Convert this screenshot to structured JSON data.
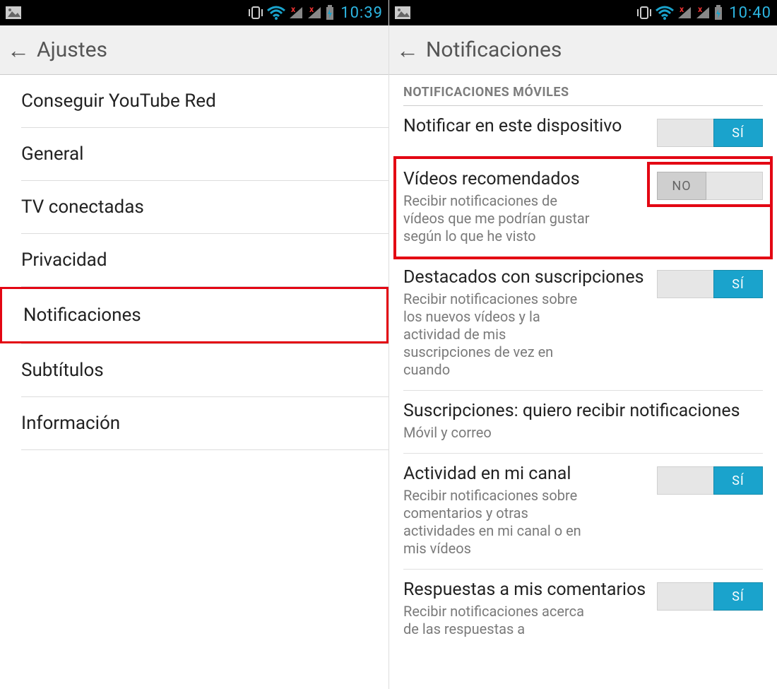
{
  "left": {
    "status_time": "10:39",
    "header_title": "Ajustes",
    "items": [
      "Conseguir YouTube Red",
      "General",
      "TV conectadas",
      "Privacidad",
      "Notificaciones",
      "Subtítulos",
      "Información"
    ],
    "highlight_index": 4
  },
  "right": {
    "status_time": "10:40",
    "header_title": "Notificaciones",
    "section_title": "NOTIFICACIONES MÓVILES",
    "items": [
      {
        "title": "Notificar en este dispositivo",
        "desc": "",
        "toggle": "SÍ",
        "on": true
      },
      {
        "title": "Vídeos recomendados",
        "desc": "Recibir notificaciones de vídeos que me podrían gustar según lo que he visto",
        "toggle": "NO",
        "on": false,
        "highlight": true
      },
      {
        "title": "Destacados con suscripciones",
        "desc": "Recibir notificaciones sobre los nuevos vídeos y la actividad de mis suscripciones de vez en cuando",
        "toggle": "SÍ",
        "on": true
      },
      {
        "title": "Suscripciones: quiero recibir notificaciones",
        "desc": "Móvil y correo",
        "toggle": null,
        "on": null
      },
      {
        "title": "Actividad en mi canal",
        "desc": "Recibir notificaciones sobre comentarios y otras actividades en mi canal o en mis vídeos",
        "toggle": "SÍ",
        "on": true
      },
      {
        "title": "Respuestas a mis comentarios",
        "desc": "Recibir notificaciones acerca de las respuestas a",
        "toggle": "SÍ",
        "on": true
      }
    ]
  },
  "icons": {
    "picture": "picture-icon",
    "vibrate": "vibrate-icon",
    "wifi": "wifi-icon",
    "signal_x": "signal-no-icon",
    "battery": "battery-charging-icon"
  }
}
